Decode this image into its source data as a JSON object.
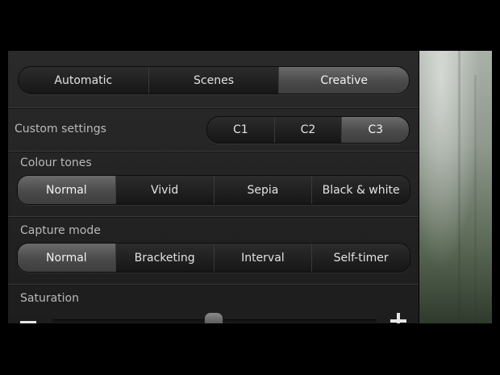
{
  "mode_tabs": [
    {
      "label": "Automatic",
      "selected": false
    },
    {
      "label": "Scenes",
      "selected": false
    },
    {
      "label": "Creative",
      "selected": true
    }
  ],
  "custom_settings": {
    "label": "Custom settings",
    "options": [
      {
        "label": "C1",
        "selected": false
      },
      {
        "label": "C2",
        "selected": false
      },
      {
        "label": "C3",
        "selected": true
      }
    ]
  },
  "colour_tones": {
    "label": "Colour tones",
    "options": [
      {
        "label": "Normal",
        "selected": true
      },
      {
        "label": "Vivid",
        "selected": false
      },
      {
        "label": "Sepia",
        "selected": false
      },
      {
        "label": "Black & white",
        "selected": false
      }
    ]
  },
  "capture_mode": {
    "label": "Capture mode",
    "options": [
      {
        "label": "Normal",
        "selected": true
      },
      {
        "label": "Bracketing",
        "selected": false
      },
      {
        "label": "Interval",
        "selected": false
      },
      {
        "label": "Self-timer",
        "selected": false
      }
    ]
  },
  "saturation": {
    "label": "Saturation",
    "value_fraction": 0.5,
    "decrease_icon": "minus-icon",
    "increase_icon": "plus-icon"
  }
}
